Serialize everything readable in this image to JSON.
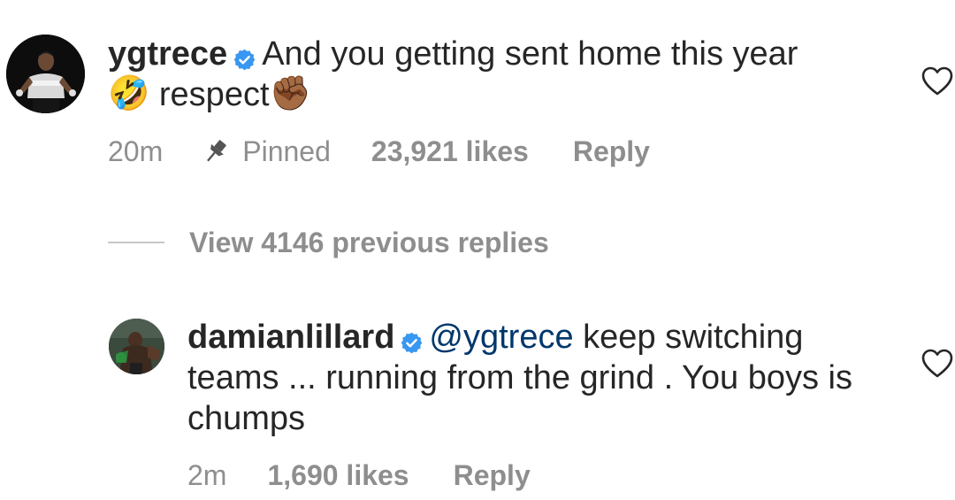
{
  "comments": [
    {
      "username": "ygtrece",
      "text_part1": "And you getting sent home this year",
      "emoji1": "🤣",
      "text_part2": "respect",
      "emoji2": "✊🏾",
      "time": "20m",
      "pinned_label": "Pinned",
      "likes": "23,921 likes",
      "reply_label": "Reply"
    },
    {
      "username": "damianlillard",
      "mention": "@ygtrece",
      "text": "keep switching teams ... running from the grind . You boys is chumps",
      "time": "2m",
      "likes": "1,690 likes",
      "reply_label": "Reply"
    }
  ],
  "view_replies_label": "View 4146 previous replies",
  "colors": {
    "text": "#262626",
    "muted": "#8e8e8e",
    "verified": "#3897f0",
    "mention": "#00376b",
    "divider": "#c7c7c7"
  },
  "icons": {
    "verified": "verified-badge-icon",
    "pin": "pin-icon",
    "like": "heart-outline-icon"
  }
}
